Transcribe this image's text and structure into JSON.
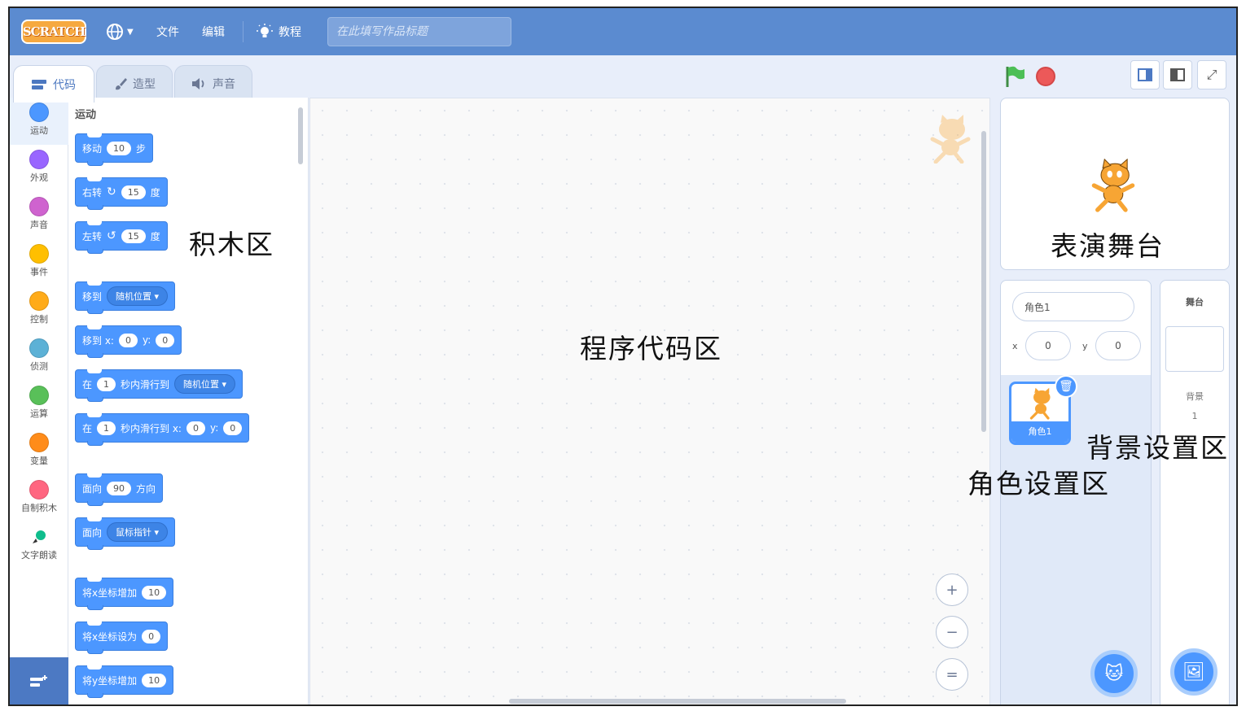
{
  "menubar": {
    "logo": "SCRATCH",
    "language_icon": "globe-icon",
    "file": "文件",
    "edit": "编辑",
    "tutorials": "教程",
    "title_placeholder": "在此填写作品标题"
  },
  "tabs": [
    {
      "label": "代码",
      "icon": "code-icon"
    },
    {
      "label": "造型",
      "icon": "brush-icon"
    },
    {
      "label": "声音",
      "icon": "speaker-icon"
    }
  ],
  "categories": [
    {
      "label": "运动",
      "color": "#4c97ff"
    },
    {
      "label": "外观",
      "color": "#9966ff"
    },
    {
      "label": "声音",
      "color": "#cf63cf"
    },
    {
      "label": "事件",
      "color": "#ffbf00"
    },
    {
      "label": "控制",
      "color": "#ffab19"
    },
    {
      "label": "侦测",
      "color": "#5cb1d6"
    },
    {
      "label": "运算",
      "color": "#59c059"
    },
    {
      "label": "变量",
      "color": "#ff8c1a"
    },
    {
      "label": "自制积木",
      "color": "#ff6680"
    },
    {
      "label": "文字朗读",
      "color": "#0fbd8c"
    }
  ],
  "palette": {
    "section_title": "运动",
    "blocks": {
      "move": {
        "a": "移动",
        "n": "10",
        "b": "步"
      },
      "turn_right": {
        "a": "右转",
        "n": "15",
        "b": "度"
      },
      "turn_left": {
        "a": "左转",
        "n": "15",
        "b": "度"
      },
      "goto": {
        "a": "移到",
        "dd": "随机位置"
      },
      "goto_xy": {
        "a": "移到 x:",
        "x": "0",
        "ylab": "y:",
        "y": "0"
      },
      "glide": {
        "a": "在",
        "n": "1",
        "b": "秒内滑行到",
        "dd": "随机位置"
      },
      "glide_xy": {
        "a": "在",
        "n": "1",
        "b": "秒内滑行到 x:",
        "x": "0",
        "ylab": "y:",
        "y": "0"
      },
      "point": {
        "a": "面向",
        "n": "90",
        "b": "方向"
      },
      "point_towards": {
        "a": "面向",
        "dd": "鼠标指针"
      },
      "change_x": {
        "a": "将x坐标增加",
        "n": "10"
      },
      "set_x": {
        "a": "将x坐标设为",
        "n": "0"
      },
      "change_y": {
        "a": "将y坐标增加",
        "n": "10"
      }
    }
  },
  "sprite_info": {
    "name": "角色1",
    "x_label": "x",
    "x_value": "0",
    "y_label": "y",
    "y_value": "0",
    "thumb_label": "角色1"
  },
  "backdrop": {
    "title": "舞台",
    "label": "背景",
    "count": "1"
  },
  "zoom_controls": [
    "+",
    "−",
    "="
  ],
  "annotations": {
    "palette_area": "积木区",
    "code_area": "程序代码区",
    "stage_area": "表演舞台",
    "backdrop_area": "背景设置区",
    "sprite_area": "角色设置区"
  },
  "colors": {
    "menubar": "#5b8bd0",
    "motion": "#4c97ff",
    "green_flag": "#4cbf56",
    "stop": "#ec5959"
  }
}
